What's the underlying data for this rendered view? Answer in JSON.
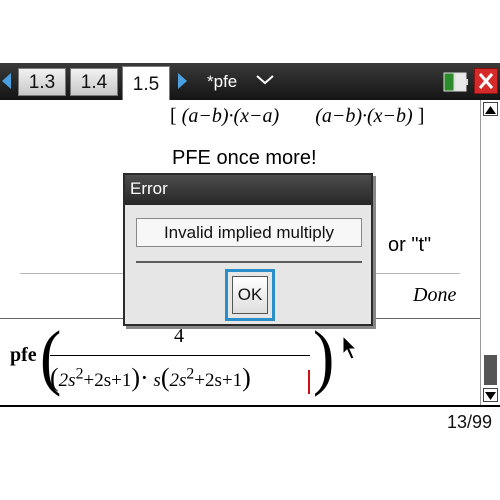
{
  "tabs": [
    {
      "label": "1.3"
    },
    {
      "label": "1.4"
    },
    {
      "label": "1.5",
      "active": true
    }
  ],
  "document": {
    "name": "*pfe"
  },
  "content": {
    "matrix_row": [
      "(a−b)·(x−a)",
      "(a−b)·(x−b)"
    ],
    "note_text": "PFE once more!",
    "or_t_text": "or \"t\"",
    "done_label": "Done",
    "expression": {
      "function": "pfe",
      "numerator": "4",
      "denominator_parts": [
        "(",
        "2s",
        "2",
        "+2s+1",
        ")·",
        "s",
        "(",
        "2s",
        "2",
        "+2s+1",
        ")"
      ]
    }
  },
  "dialog": {
    "title": "Error",
    "message": "Invalid implied multiply",
    "ok_label": "OK"
  },
  "status": {
    "page_counter": "13/99"
  },
  "colors": {
    "accent": "#2a8fc8",
    "close": "#d42a2a",
    "arrow": "#4aa0e0"
  }
}
